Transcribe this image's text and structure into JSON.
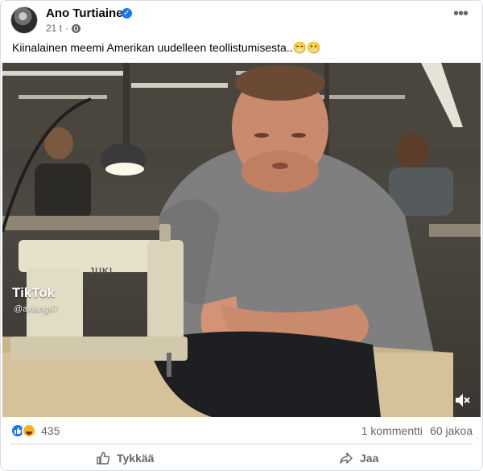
{
  "post": {
    "author": "Ano Turtiainen",
    "time": "21 t",
    "caption": "Kiinalainen meemi Amerikan uudelleen teollistumisesta..😁😬"
  },
  "video": {
    "watermark_brand": "TikTok",
    "watermark_handle": "@axiang67",
    "machine_brand": "JUKI"
  },
  "stats": {
    "reaction_count": "435",
    "comments": "1 kommentti",
    "shares": "60 jakoa"
  },
  "actions": {
    "like_label": "Tykkää",
    "share_label": "Jaa"
  },
  "icons": [
    "globe-icon",
    "more-icon",
    "mute-icon",
    "like-icon",
    "haha-icon",
    "thumb-up-icon",
    "share-arrow-icon"
  ],
  "colors": {
    "accent": "#1877f2",
    "secondary_text": "#65676b",
    "divider": "#ced0d4"
  }
}
